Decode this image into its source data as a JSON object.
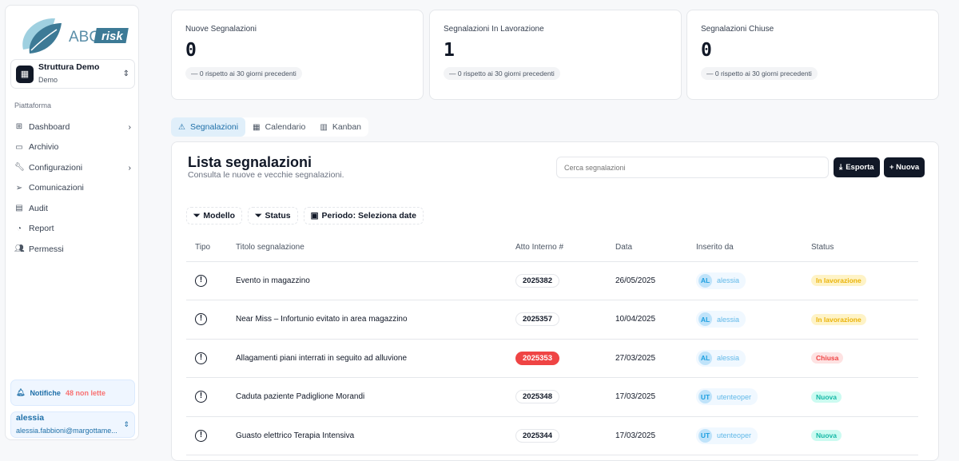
{
  "brand": {
    "name": "ABC risk",
    "accent": "#3d7a96"
  },
  "org": {
    "name": "Struttura Demo",
    "sub": "Demo"
  },
  "sidebar": {
    "section": "Piattaforma",
    "items": [
      {
        "label": "Dashboard",
        "icon": "dashboard-icon",
        "chevron": true
      },
      {
        "label": "Archivio",
        "icon": "archive-icon",
        "chevron": false
      },
      {
        "label": "Configurazioni",
        "icon": "wrench-icon",
        "chevron": true
      },
      {
        "label": "Comunicazioni",
        "icon": "send-icon",
        "chevron": false
      },
      {
        "label": "Audit",
        "icon": "clipboard-icon",
        "chevron": false
      },
      {
        "label": "Report",
        "icon": "pie-chart-icon",
        "chevron": false
      },
      {
        "label": "Permessi",
        "icon": "users-icon",
        "chevron": false
      }
    ]
  },
  "notifications": {
    "label": "Notifiche",
    "count": "48 non lette"
  },
  "user": {
    "name": "alessia",
    "email": "alessia.fabbioni@margottame..."
  },
  "stats": [
    {
      "title": "Nuove Segnalazioni",
      "value": "0",
      "change": "— 0 rispetto ai 30 giorni precedenti"
    },
    {
      "title": "Segnalazioni In Lavorazione",
      "value": "1",
      "change": "— 0 rispetto ai 30 giorni precedenti"
    },
    {
      "title": "Segnalazioni Chiuse",
      "value": "0",
      "change": "— 0 rispetto ai 30 giorni precedenti"
    }
  ],
  "tabs": [
    {
      "label": "Segnalazioni",
      "active": true
    },
    {
      "label": "Calendario"
    },
    {
      "label": "Kanban"
    }
  ],
  "list": {
    "title": "Lista segnalazioni",
    "subtitle": "Consulta le nuove e vecchie segnalazioni.",
    "search_placeholder": "Cerca segnalazioni",
    "export": "Esporta",
    "new": "+ Nuova"
  },
  "filters": [
    "Modello",
    "Status",
    "Periodo: Seleziona date"
  ],
  "table": {
    "columns": [
      "Tipo",
      "Titolo segnalazione",
      "Atto Interno #",
      "Data",
      "Inserito da",
      "Status"
    ],
    "rows": [
      {
        "title": "Evento in magazzino",
        "atto": "2025382",
        "atto_alert": false,
        "date": "26/05/2025",
        "initials": "AL",
        "user": "alessia",
        "status": "In lavorazione"
      },
      {
        "title": "Near Miss – Infortunio evitato in area magazzino",
        "atto": "2025357",
        "atto_alert": false,
        "date": "10/04/2025",
        "initials": "AL",
        "user": "alessia",
        "status": "In lavorazione"
      },
      {
        "title": "Allagamenti piani interrati in seguito ad alluvione",
        "atto": "2025353",
        "atto_alert": true,
        "date": "27/03/2025",
        "initials": "AL",
        "user": "alessia",
        "status": "Chiusa"
      },
      {
        "title": "Caduta paziente Padiglione Morandi",
        "atto": "2025348",
        "atto_alert": false,
        "date": "17/03/2025",
        "initials": "UT",
        "user": "utenteoper",
        "status": "Nuova"
      },
      {
        "title": "Guasto elettrico Terapia Intensiva",
        "atto": "2025344",
        "atto_alert": false,
        "date": "17/03/2025",
        "initials": "UT",
        "user": "utenteoper",
        "status": "Nuova"
      }
    ]
  },
  "status_colors": {
    "In lavorazione": {
      "bg": "#fef3c7",
      "fg": "#eab308"
    },
    "Chiusa": {
      "bg": "#fee2e2",
      "fg": "#ef4444"
    },
    "Nuova": {
      "bg": "#ccfbf1",
      "fg": "#14b8a6"
    }
  }
}
